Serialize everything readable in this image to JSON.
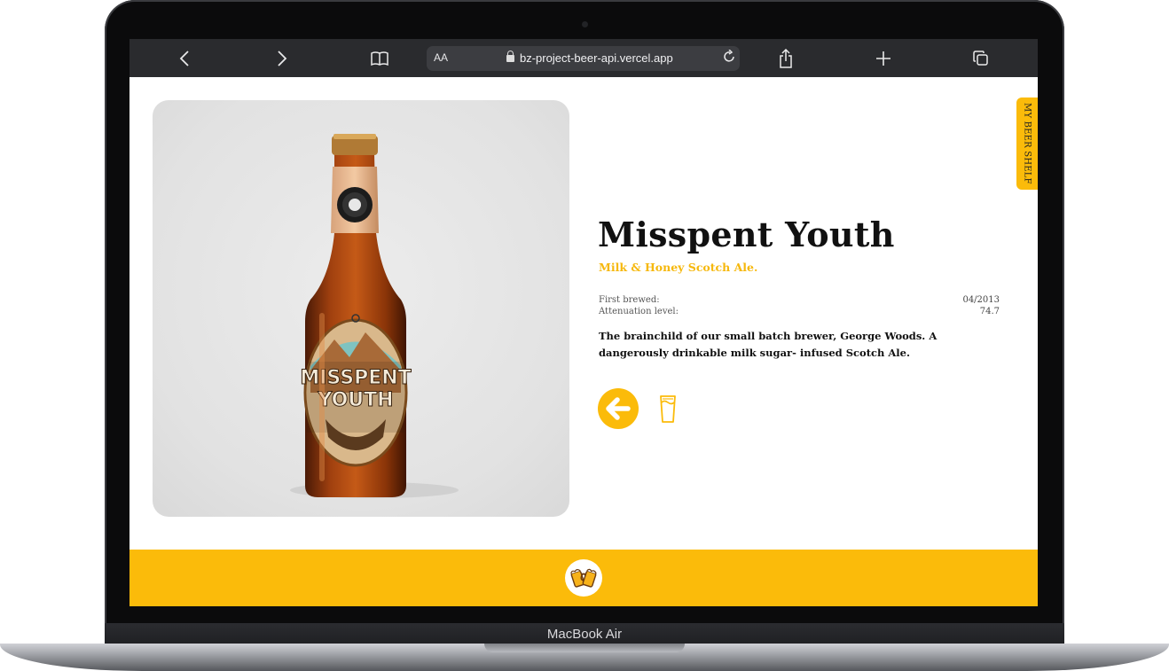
{
  "device": {
    "label": "MacBook Air"
  },
  "browser": {
    "url": "bz-project-beer-api.vercel.app",
    "text_size_label": "AA",
    "icons": [
      "chevron-left-icon",
      "chevron-right-icon",
      "book-icon",
      "lock-icon",
      "reload-icon",
      "share-icon",
      "plus-icon",
      "tabs-icon"
    ]
  },
  "page": {
    "shelf_tab_label": "MY BEER SHELF",
    "beer": {
      "name": "Misspent Youth",
      "tagline": "Milk & Honey Scotch Ale.",
      "first_brewed_label": "First brewed:",
      "first_brewed": "04/2013",
      "attenuation_label": "Attenuation level:",
      "attenuation": "74.7",
      "description": "The brainchild of our small batch brewer, George Woods. A dangerously drinkable milk sugar- infused Scotch Ale.",
      "label_line1": "MISSPENT",
      "label_line2": "YOUTH"
    },
    "accent_color": "#fbbb0a",
    "actions": {
      "back": "arrow-left-icon",
      "add": "beer-glass-icon"
    },
    "footer_logo": "cheers-mugs-icon"
  }
}
